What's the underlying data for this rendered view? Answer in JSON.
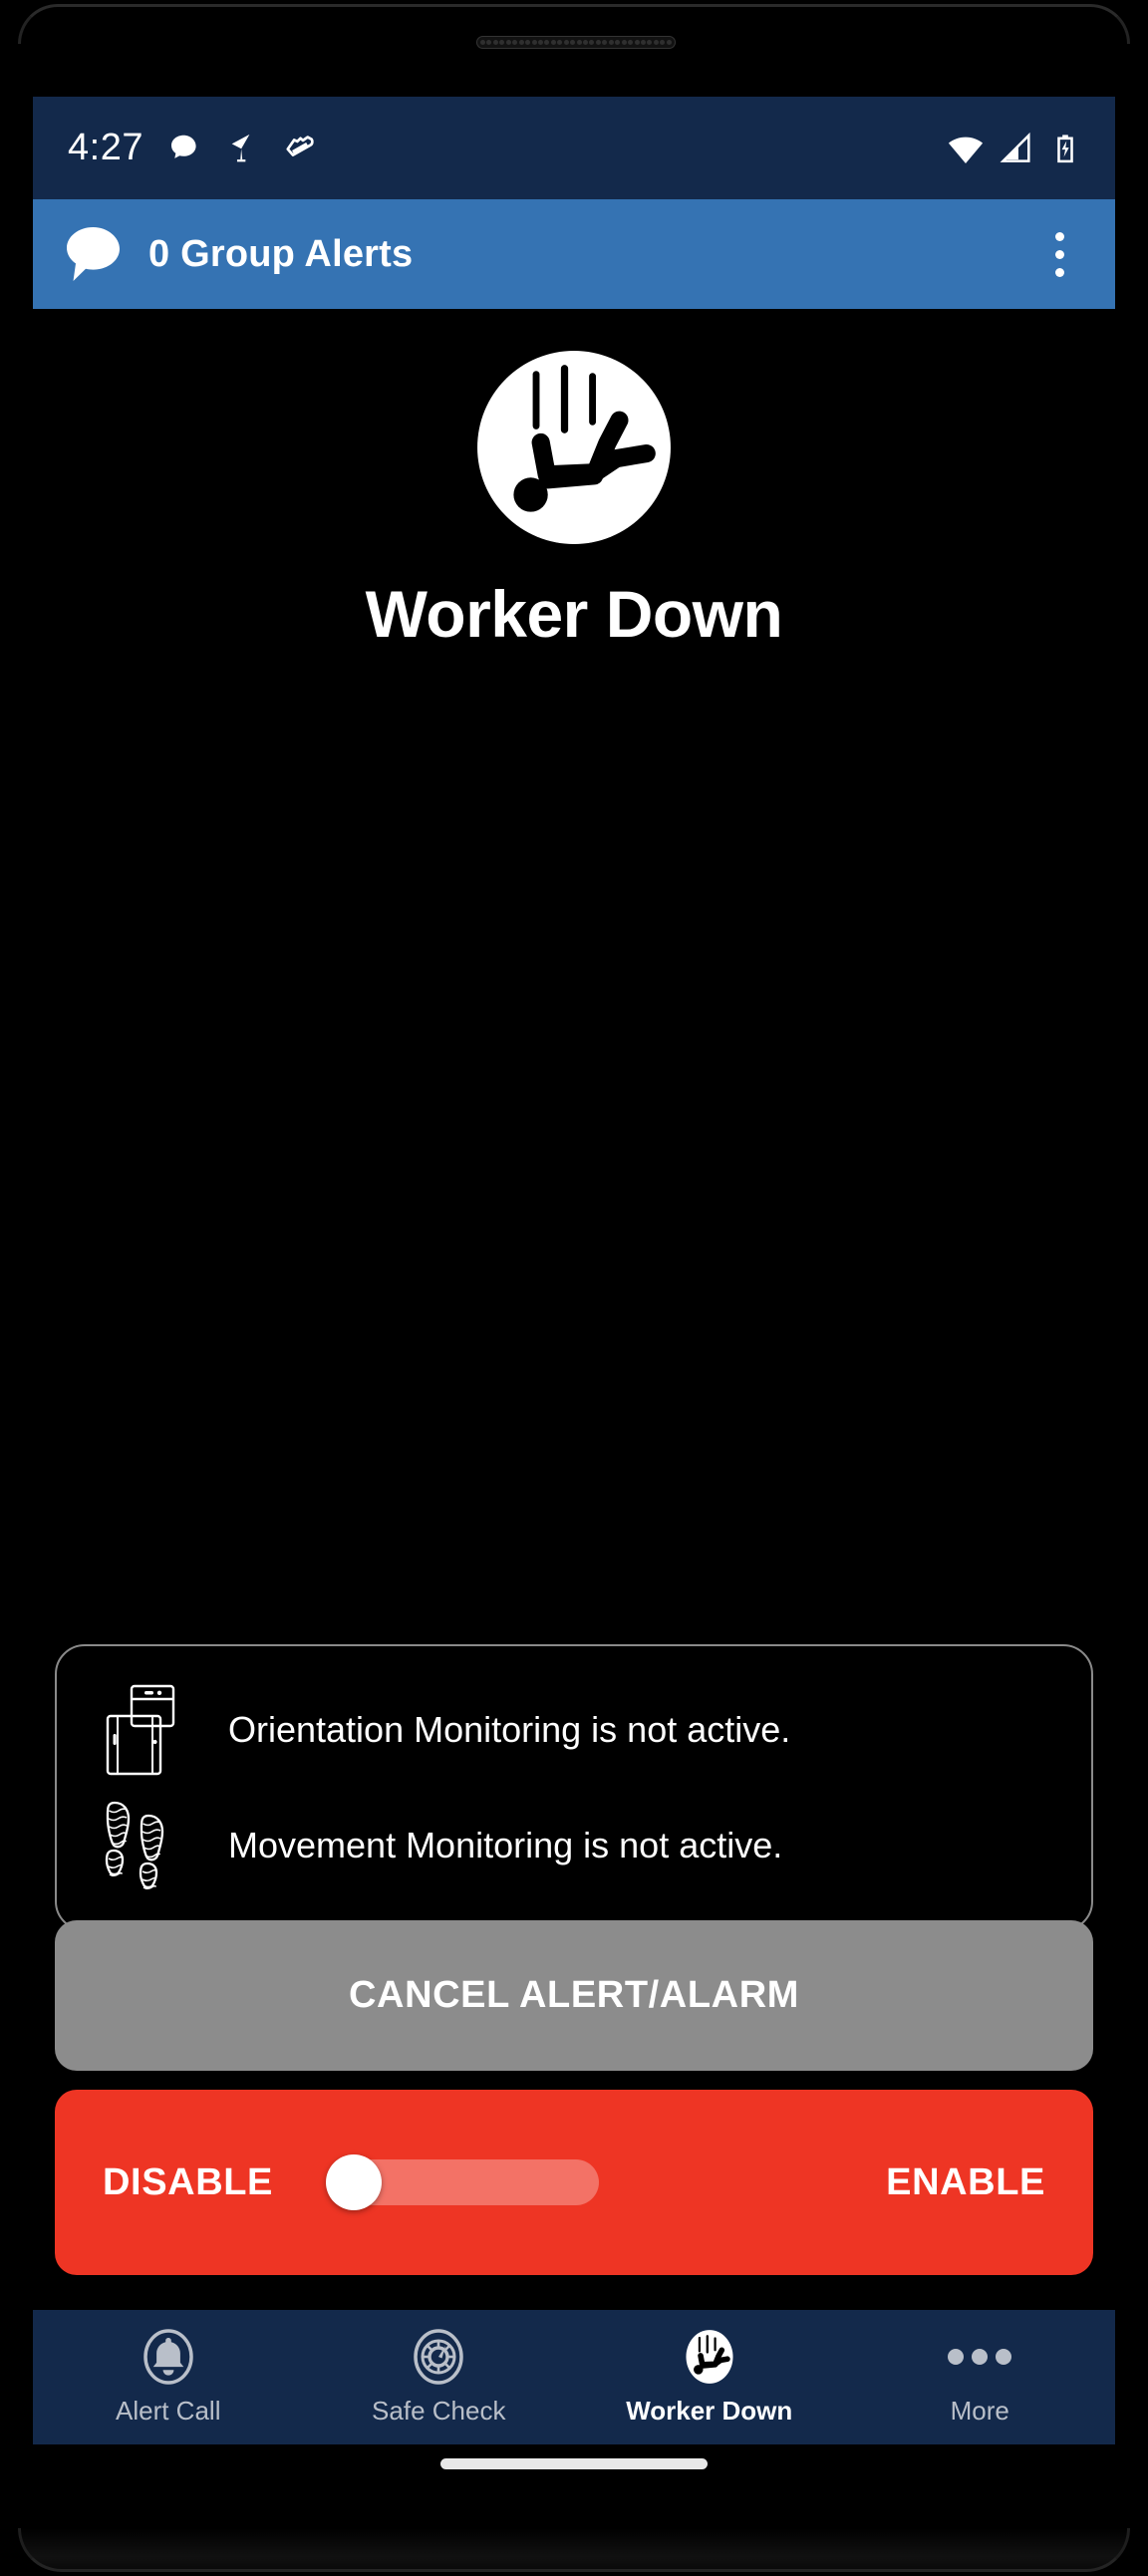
{
  "theme": {
    "status_bar_bg": "#13294b",
    "app_bar_bg": "#3573b3",
    "screen_bg": "#000000",
    "accent_red": "#ee3524",
    "cancel_grey": "#8c8c8c",
    "nav_bg": "#13294b",
    "nav_inactive": "#b9bfc9",
    "nav_active": "#ffffff"
  },
  "status_bar": {
    "time": "4:27",
    "left_icons": [
      "message-bubble-icon",
      "flag-icon",
      "shoe-icon"
    ],
    "right_icons": [
      "wifi-icon",
      "cellular-signal-icon",
      "battery-charging-icon"
    ]
  },
  "app_bar": {
    "icon": "speech-bubble-icon",
    "title": "0 Group Alerts",
    "overflow": "overflow-menu-icon"
  },
  "hero": {
    "icon": "worker-down-icon",
    "title": "Worker Down"
  },
  "status_card": {
    "rows": [
      {
        "icon": "phone-orientation-icon",
        "text": "Orientation Monitoring is not active."
      },
      {
        "icon": "footprints-icon",
        "text": "Movement Monitoring is not active."
      }
    ]
  },
  "cancel_button": {
    "label": "CANCEL ALERT/ALARM"
  },
  "toggle": {
    "left_label": "DISABLE",
    "right_label": "ENABLE",
    "state": "disabled",
    "thumb_position": "left"
  },
  "bottom_nav": {
    "items": [
      {
        "label": "Alert Call",
        "icon": "bell-icon",
        "active": false
      },
      {
        "label": "Safe Check",
        "icon": "gauge-icon",
        "active": false
      },
      {
        "label": "Worker Down",
        "icon": "worker-down-icon",
        "active": true
      },
      {
        "label": "More",
        "icon": "more-dots-icon",
        "active": false
      }
    ]
  }
}
